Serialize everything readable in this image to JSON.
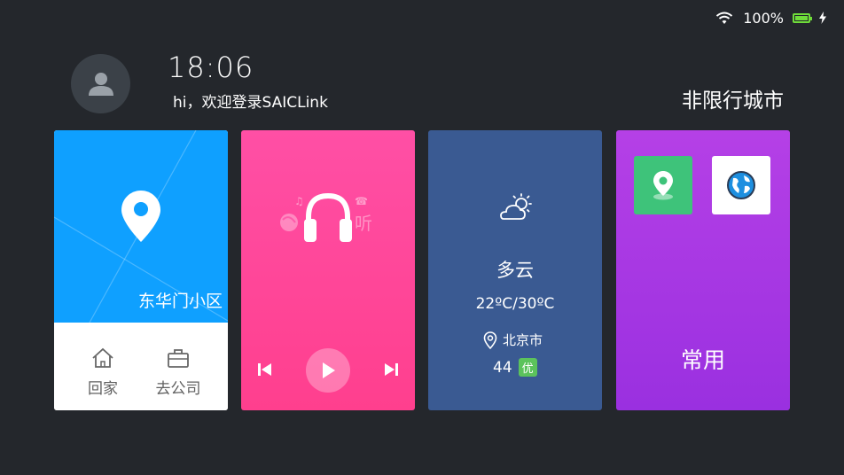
{
  "status_bar": {
    "wifi_icon": "wifi-icon",
    "battery_percent": "100%",
    "battery_level": 1.0,
    "charging_icon": "bolt-icon",
    "battery_color": "#6fdc3a"
  },
  "header": {
    "time": "18:06",
    "welcome": "hi，欢迎登录SAICLink",
    "restriction": "非限行城市"
  },
  "navigation_card": {
    "address": "东华门小区",
    "home_label": "回家",
    "company_label": "去公司",
    "color": "#0fa0ff"
  },
  "music_card": {
    "color": "#ff4fa5",
    "watermark": "听"
  },
  "weather_card": {
    "condition": "多云",
    "temperature": "22ºC/30ºC",
    "city": "北京市",
    "aqi_value": "44",
    "aqi_level": "优",
    "color": "#3a5a92"
  },
  "apps_card": {
    "label": "常用",
    "color": "#b540e6"
  }
}
